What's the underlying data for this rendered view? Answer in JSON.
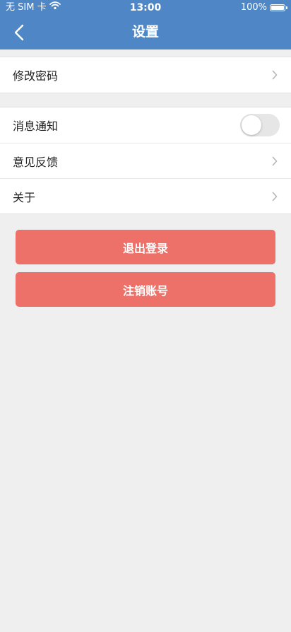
{
  "status_bar": {
    "carrier": "无 SIM 卡",
    "time": "13:00",
    "battery": "100%"
  },
  "navbar": {
    "title": "设置",
    "back_icon": "chevron-left-icon"
  },
  "sections": [
    {
      "rows": [
        {
          "label": "修改密码",
          "accessory": "chevron"
        }
      ]
    },
    {
      "rows": [
        {
          "label": "消息通知",
          "accessory": "toggle",
          "toggle_on": false
        },
        {
          "label": "意见反馈",
          "accessory": "chevron"
        },
        {
          "label": "关于",
          "accessory": "chevron"
        }
      ]
    }
  ],
  "buttons": {
    "logout": "退出登录",
    "delete_account": "注销账号"
  },
  "colors": {
    "header": "#4f86c6",
    "background": "#efefef",
    "button": "#ee7169"
  }
}
